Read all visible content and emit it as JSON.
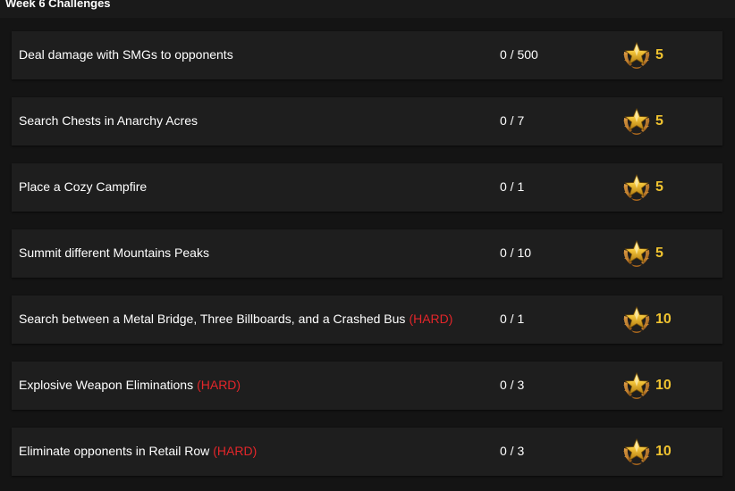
{
  "header": {
    "title": "Week 6 Challenges"
  },
  "challenges": [
    {
      "name": "Deal damage with SMGs to opponents",
      "tag": "",
      "progress": "0 / 500",
      "stars": "5"
    },
    {
      "name": "Search Chests in Anarchy Acres",
      "tag": "",
      "progress": "0 / 7",
      "stars": "5"
    },
    {
      "name": "Place a Cozy Campfire",
      "tag": "",
      "progress": "0 / 1",
      "stars": "5"
    },
    {
      "name": "Summit different Mountains Peaks",
      "tag": "",
      "progress": "0 / 10",
      "stars": "5"
    },
    {
      "name": "Search between a Metal Bridge, Three Billboards, and a Crashed Bus",
      "tag": "(HARD)",
      "progress": "0 / 1",
      "stars": "10"
    },
    {
      "name": "Explosive Weapon Eliminations",
      "tag": "(HARD)",
      "progress": "0 / 3",
      "stars": "10"
    },
    {
      "name": "Eliminate opponents in Retail Row",
      "tag": "(HARD)",
      "progress": "0 / 3",
      "stars": "10"
    }
  ],
  "colors": {
    "background": "#141414",
    "row_background": "#1e1e1e",
    "hard_tag": "#e3262a",
    "star_count": "#f0c330"
  },
  "icons": {
    "reward": "battle-star-icon"
  }
}
